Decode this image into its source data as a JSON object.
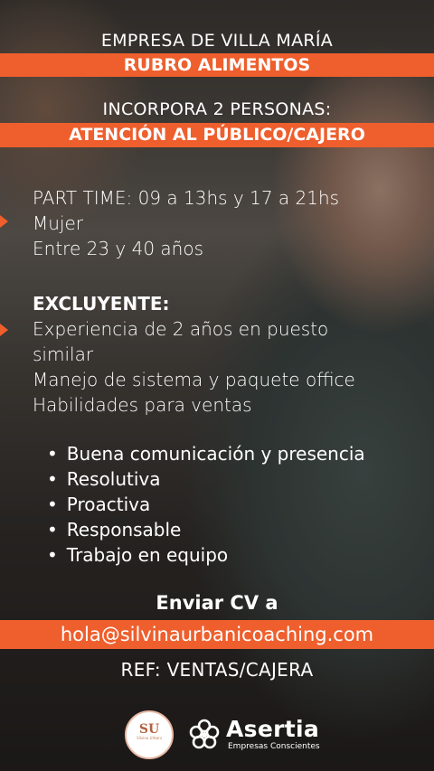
{
  "header": {
    "company": "EMPRESA DE VILLA MARÍA",
    "sector": "RUBRO ALIMENTOS",
    "hiring": "INCORPORA 2 PERSONAS:",
    "position": "ATENCIÓN AL PÚBLICO/CAJERO"
  },
  "details": [
    "PART TIME: 09 a 13hs y 17 a 21hs",
    "Mujer",
    "Entre 23 y 40 años"
  ],
  "requirements": {
    "heading": "EXCLUYENTE:",
    "items": [
      "Experiencia de 2 años en puesto",
      "similar",
      "Manejo de sistema y paquete office",
      "Habilidades para ventas"
    ]
  },
  "skills": [
    "Buena comunicación y presencia",
    "Resolutiva",
    "Proactiva",
    "Responsable",
    "Trabajo en equipo"
  ],
  "contact": {
    "cta": "Enviar CV a",
    "email": "hola@silvinaurbanicoaching.com",
    "reference": "REF: VENTAS/CAJERA"
  },
  "logos": {
    "su_monogram": "SU",
    "su_caption": "Silvina Urbani",
    "asertia_name": "Asertia",
    "asertia_tagline": "Empresas Conscientes"
  },
  "colors": {
    "accent": "#ee5f2d",
    "text": "#ffffff"
  }
}
